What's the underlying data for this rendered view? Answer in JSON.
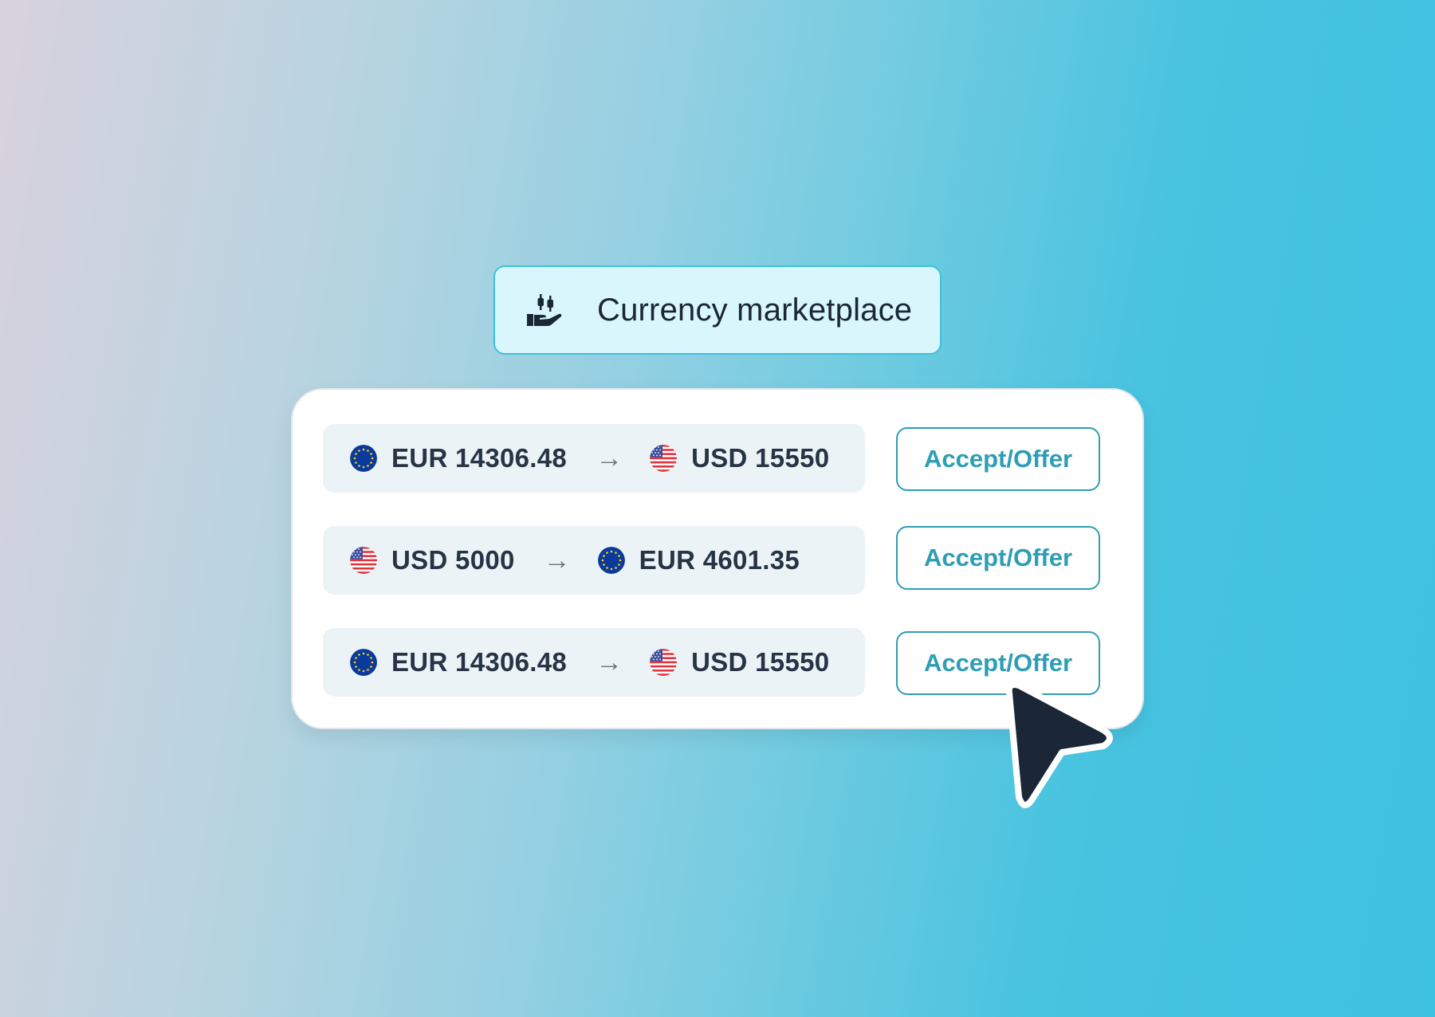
{
  "header": {
    "title": "Currency marketplace",
    "icon": "hand-candlestick-icon"
  },
  "offers": [
    {
      "from_currency": "EUR",
      "from_amount": "EUR 14306.48",
      "from_flag": "eu-flag-icon",
      "to_currency": "USD",
      "to_amount": "USD 15550",
      "to_flag": "us-flag-icon",
      "action_label": "Accept/Offer"
    },
    {
      "from_currency": "USD",
      "from_amount": "USD 5000",
      "from_flag": "us-flag-icon",
      "to_currency": "EUR",
      "to_amount": "EUR 4601.35",
      "to_flag": "eu-flag-icon",
      "action_label": "Accept/Offer"
    },
    {
      "from_currency": "EUR",
      "from_amount": "EUR 14306.48",
      "from_flag": "eu-flag-icon",
      "to_currency": "USD",
      "to_amount": "USD 15550",
      "to_flag": "us-flag-icon",
      "action_label": "Accept/Offer"
    }
  ],
  "arrow_glyph": "→",
  "colors": {
    "accent": "#2e9db6",
    "badge_bg": "#d8f6fb",
    "row_bg": "#ebf3f7",
    "text": "#263445",
    "cursor": "#1b2736"
  }
}
